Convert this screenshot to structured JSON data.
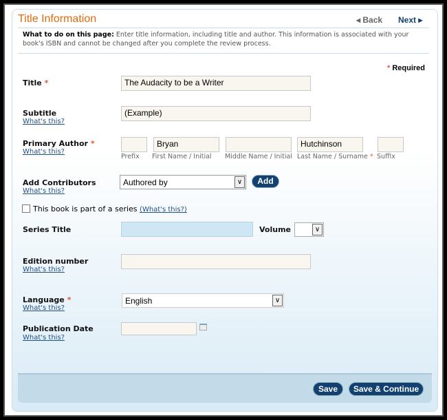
{
  "header": {
    "title": "Title Information",
    "back": "Back",
    "next": "Next"
  },
  "instructions": {
    "lead": "What to do on this page:",
    "text": " Enter title information, including title and author. This information is associated with your book's ISBN and cannot be changed after you complete the review process."
  },
  "required_note": "Required",
  "help_link": "What's this?",
  "fields": {
    "title": {
      "label": "Title",
      "value": "The Audacity to be a Writer"
    },
    "subtitle": {
      "label": "Subtitle",
      "value": "(Example)"
    },
    "primary_author": {
      "label": "Primary Author",
      "prefix": "",
      "first": "Bryan",
      "middle": "",
      "last": "Hutchinson",
      "suffix": "",
      "sublabels": {
        "prefix": "Prefix",
        "first": "First Name / Initial",
        "middle": "Middle Name / Initial",
        "last": "Last Name / Surname",
        "suffix": "Suffix"
      }
    },
    "contributors": {
      "label": "Add Contributors",
      "selected": "Authored by",
      "add": "Add"
    },
    "series_checkbox": {
      "label": "This book is part of a series",
      "help": "(What's this?)",
      "checked": false
    },
    "series_title": {
      "label": "Series Title",
      "value": ""
    },
    "volume": {
      "label": "Volume",
      "selected": ""
    },
    "edition": {
      "label": "Edition number",
      "value": ""
    },
    "language": {
      "label": "Language",
      "selected": "English"
    },
    "pub_date": {
      "label": "Publication Date",
      "value": ""
    }
  },
  "footer": {
    "save": "Save",
    "save_continue": "Save & Continue"
  },
  "colors": {
    "title": "#e06a10",
    "button": "#12406f",
    "required": "#e8563c",
    "link": "#1d4e84"
  }
}
